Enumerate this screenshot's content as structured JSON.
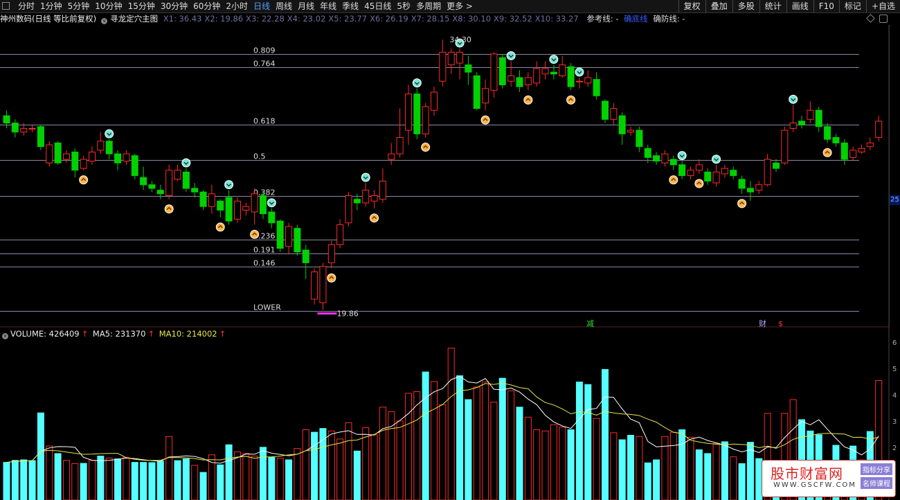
{
  "toolbar": {
    "tabs": [
      {
        "label": "分时",
        "active": false
      },
      {
        "label": "1分钟",
        "active": false
      },
      {
        "label": "5分钟",
        "active": false
      },
      {
        "label": "10分钟",
        "active": false
      },
      {
        "label": "15分钟",
        "active": false
      },
      {
        "label": "30分钟",
        "active": false
      },
      {
        "label": "60分钟",
        "active": false
      },
      {
        "label": "2小时",
        "active": false
      },
      {
        "label": "日线",
        "active": true
      },
      {
        "label": "周线",
        "active": false
      },
      {
        "label": "月线",
        "active": false
      },
      {
        "label": "年线",
        "active": false
      },
      {
        "label": "季线",
        "active": false
      },
      {
        "label": "45日线",
        "active": false
      },
      {
        "label": "5秒",
        "active": false
      },
      {
        "label": "多周期",
        "active": false
      },
      {
        "label": "更多 >",
        "active": false
      }
    ],
    "right_buttons": [
      "复权",
      "叠加",
      "多股",
      "统计",
      "画线",
      "F10",
      "标记",
      "+自选"
    ]
  },
  "info_line": {
    "stock": "神州数码(日线 等比前复权)",
    "indicator": "寻龙定穴主图",
    "values": [
      "X1: 36.43",
      "X2: 19.86",
      "X3: 22.28",
      "X4: 23.02",
      "X5: 23.77",
      "X6: 26.19",
      "X7: 28.15",
      "X8: 30.10",
      "X9: 32.52",
      "X10: 33.27"
    ],
    "ref_label": "参考线: -",
    "mid_label": "确底线",
    "conf_label": "确防线: -"
  },
  "fib_levels": [
    {
      "label": "0.809",
      "value": 34.0
    },
    {
      "label": "0.764",
      "value": 33.27
    },
    {
      "label": "0.618",
      "value": 30.1
    },
    {
      "label": "0.5",
      "value": 28.15
    },
    {
      "label": "0.382",
      "value": 26.19
    },
    {
      "label": "0.236",
      "value": 23.77
    },
    {
      "label": "0.191",
      "value": 23.02
    },
    {
      "label": "0.146",
      "value": 22.28
    },
    {
      "label": "LOWER",
      "value": 19.86
    }
  ],
  "high_label": "34.30",
  "low_label": "19.86",
  "markers_text": {
    "jian": "减",
    "cai": "财",
    "dollar": "$"
  },
  "right_axis_value": "25",
  "volume": {
    "label": "VOLUME: 426409",
    "ma5": "MA5: 231370",
    "ma10": "MA10: 214002",
    "axis_ticks": [
      "6",
      "5",
      "4",
      "3",
      "2"
    ]
  },
  "watermark": {
    "title": "股市财富网",
    "url": "WWW.GSCFW.COM",
    "badge1": "指标分享",
    "badge2": "名师课程"
  },
  "colors": {
    "up": "#ff2a2a",
    "down": "#00d100",
    "vol_down": "#55ffff",
    "ma5": "#ffffff",
    "ma10": "#e8e84a",
    "fib": "#8a8aa8"
  },
  "chart_data": {
    "type": "candlestick",
    "ylim": [
      19.2,
      35.6
    ],
    "candles": [
      [
        30.6,
        30.2,
        30.9,
        29.9
      ],
      [
        30.2,
        29.7,
        30.4,
        29.4
      ],
      [
        29.7,
        29.9,
        30.2,
        29.5
      ],
      [
        29.9,
        29.9,
        30.1,
        29.7
      ],
      [
        30.0,
        28.9,
        30.1,
        28.7
      ],
      [
        28.0,
        29.0,
        29.2,
        27.8
      ],
      [
        29.1,
        28.0,
        29.2,
        27.9
      ],
      [
        28.2,
        28.5,
        28.7,
        28.0
      ],
      [
        28.6,
        27.6,
        28.8,
        27.2
      ],
      [
        27.7,
        28.2,
        28.4,
        27.6
      ],
      [
        28.1,
        28.6,
        28.9,
        27.9
      ],
      [
        28.7,
        29.2,
        29.7,
        28.5
      ],
      [
        29.2,
        28.5,
        29.3,
        28.2
      ],
      [
        28.5,
        28.0,
        28.7,
        27.6
      ],
      [
        28.1,
        28.5,
        28.7,
        27.9
      ],
      [
        28.4,
        27.3,
        28.5,
        27.1
      ],
      [
        27.2,
        26.8,
        27.8,
        26.5
      ],
      [
        26.8,
        26.6,
        27.0,
        26.4
      ],
      [
        26.5,
        26.3,
        26.8,
        26.0
      ],
      [
        26.2,
        27.6,
        27.9,
        26.0
      ],
      [
        27.1,
        27.6,
        27.9,
        27.0
      ],
      [
        27.5,
        26.6,
        27.7,
        26.4
      ],
      [
        26.6,
        26.4,
        26.9,
        26.1
      ],
      [
        26.4,
        25.6,
        26.5,
        25.4
      ],
      [
        25.6,
        26.3,
        26.8,
        25.2
      ],
      [
        25.9,
        25.4,
        26.0,
        25.0
      ],
      [
        26.1,
        24.8,
        26.5,
        24.6
      ],
      [
        24.9,
        25.9,
        26.1,
        24.7
      ],
      [
        25.4,
        25.6,
        25.8,
        25.1
      ],
      [
        25.3,
        26.3,
        26.6,
        24.6
      ],
      [
        26.2,
        25.2,
        26.4,
        24.9
      ],
      [
        25.3,
        24.7,
        25.5,
        24.4
      ],
      [
        24.8,
        23.3,
        24.9,
        23.1
      ],
      [
        23.4,
        24.5,
        24.7,
        23.0
      ],
      [
        24.4,
        23.1,
        24.6,
        22.9
      ],
      [
        23.2,
        22.5,
        23.5,
        21.6
      ],
      [
        20.5,
        22.0,
        22.2,
        20.2
      ],
      [
        20.3,
        22.3,
        22.5,
        19.9
      ],
      [
        22.5,
        23.5,
        23.7,
        22.2
      ],
      [
        23.5,
        24.6,
        24.9,
        23.3
      ],
      [
        24.7,
        26.2,
        26.4,
        24.5
      ],
      [
        26.0,
        25.8,
        26.3,
        25.4
      ],
      [
        25.8,
        26.5,
        26.9,
        25.6
      ],
      [
        25.9,
        26.2,
        26.5,
        25.5
      ],
      [
        26.0,
        27.0,
        27.7,
        25.8
      ],
      [
        28.2,
        28.5,
        29.1,
        27.9
      ],
      [
        28.5,
        29.4,
        31.0,
        28.3
      ],
      [
        29.8,
        31.8,
        32.3,
        29.0
      ],
      [
        31.8,
        29.6,
        32.1,
        29.3
      ],
      [
        29.6,
        31.1,
        31.3,
        29.4
      ],
      [
        30.9,
        31.9,
        32.2,
        30.6
      ],
      [
        32.5,
        34.1,
        34.8,
        32.2
      ],
      [
        33.4,
        34.1,
        34.3,
        32.9
      ],
      [
        33.5,
        34.1,
        34.3,
        32.6
      ],
      [
        33.4,
        33.0,
        33.9,
        32.3
      ],
      [
        32.8,
        31.0,
        33.0,
        30.9
      ],
      [
        31.3,
        32.1,
        32.6,
        30.9
      ],
      [
        32.0,
        34.0,
        34.1,
        31.6
      ],
      [
        33.8,
        32.3,
        34.0,
        32.1
      ],
      [
        32.5,
        32.8,
        33.6,
        32.2
      ],
      [
        32.7,
        32.2,
        33.1,
        31.9
      ],
      [
        32.3,
        32.7,
        33.0,
        32.0
      ],
      [
        32.4,
        33.2,
        33.6,
        32.2
      ],
      [
        32.9,
        33.2,
        33.6,
        32.6
      ],
      [
        33.0,
        32.9,
        33.4,
        32.6
      ],
      [
        32.8,
        33.4,
        33.9,
        32.7
      ],
      [
        33.3,
        32.2,
        33.5,
        32.0
      ],
      [
        32.5,
        32.5,
        32.7,
        32.1
      ],
      [
        32.4,
        32.7,
        33.1,
        32.2
      ],
      [
        32.6,
        31.7,
        33.0,
        31.5
      ],
      [
        31.4,
        30.4,
        31.5,
        30.2
      ],
      [
        30.4,
        31.0,
        31.3,
        30.1
      ],
      [
        30.6,
        29.6,
        30.8,
        29.0
      ],
      [
        29.7,
        29.8,
        30.0,
        29.5
      ],
      [
        29.8,
        28.9,
        30.0,
        28.6
      ],
      [
        28.8,
        28.3,
        29.0,
        28.0
      ],
      [
        28.4,
        28.1,
        28.6,
        27.9
      ],
      [
        28.0,
        28.5,
        28.7,
        27.8
      ],
      [
        28.2,
        27.9,
        28.4,
        27.6
      ],
      [
        27.9,
        27.3,
        28.1,
        27.1
      ],
      [
        27.3,
        27.6,
        27.8,
        27.1
      ],
      [
        27.6,
        27.9,
        28.2,
        27.4
      ],
      [
        27.5,
        27.0,
        27.7,
        26.8
      ],
      [
        26.9,
        27.5,
        27.9,
        26.7
      ],
      [
        27.4,
        27.7,
        27.9,
        27.2
      ],
      [
        27.6,
        27.3,
        27.8,
        27.1
      ],
      [
        27.1,
        26.6,
        27.3,
        26.3
      ],
      [
        26.6,
        26.4,
        27.0,
        25.9
      ],
      [
        26.5,
        26.8,
        27.0,
        26.3
      ],
      [
        26.8,
        28.2,
        28.5,
        26.7
      ],
      [
        28.0,
        27.7,
        28.2,
        27.5
      ],
      [
        28.0,
        29.8,
        30.0,
        27.9
      ],
      [
        29.9,
        30.2,
        31.2,
        29.7
      ],
      [
        30.3,
        30.1,
        30.6,
        29.9
      ],
      [
        30.4,
        30.9,
        31.4,
        30.2
      ],
      [
        30.9,
        30.0,
        31.1,
        29.7
      ],
      [
        30.0,
        29.3,
        30.2,
        29.1
      ],
      [
        29.4,
        29.1,
        29.6,
        28.9
      ],
      [
        29.1,
        28.2,
        29.3,
        27.9
      ],
      [
        28.3,
        28.7,
        28.9,
        28.1
      ],
      [
        28.6,
        28.8,
        29.0,
        28.5
      ],
      [
        28.9,
        29.1,
        29.4,
        28.7
      ],
      [
        29.4,
        30.3,
        30.6,
        29.2
      ]
    ],
    "volume": [
      [
        0,
        0.15
      ],
      [
        0,
        0.158
      ],
      [
        0,
        0.16
      ],
      [
        0,
        0.157
      ],
      [
        0,
        0.347
      ],
      [
        1,
        0.215
      ],
      [
        0,
        0.185
      ],
      [
        1,
        0.158
      ],
      [
        1,
        0.145
      ],
      [
        0,
        0.146
      ],
      [
        1,
        0.158
      ],
      [
        0,
        0.175
      ],
      [
        1,
        0.167
      ],
      [
        0,
        0.164
      ],
      [
        1,
        0.17
      ],
      [
        0,
        0.15
      ],
      [
        0,
        0.15
      ],
      [
        0,
        0.149
      ],
      [
        0,
        0.155
      ],
      [
        1,
        0.253
      ],
      [
        0,
        0.157
      ],
      [
        0,
        0.164
      ],
      [
        1,
        0.138
      ],
      [
        0,
        0.11
      ],
      [
        1,
        0.18
      ],
      [
        0,
        0.14
      ],
      [
        0,
        0.22
      ],
      [
        1,
        0.192
      ],
      [
        1,
        0.185
      ],
      [
        1,
        0.175
      ],
      [
        0,
        0.21
      ],
      [
        0,
        0.17
      ],
      [
        1,
        0.167
      ],
      [
        0,
        0.16
      ],
      [
        1,
        0.205
      ],
      [
        1,
        0.28
      ],
      [
        0,
        0.27
      ],
      [
        0,
        0.285
      ],
      [
        1,
        0.275
      ],
      [
        1,
        0.243
      ],
      [
        1,
        0.308
      ],
      [
        0,
        0.195
      ],
      [
        1,
        0.288
      ],
      [
        1,
        0.26
      ],
      [
        1,
        0.37
      ],
      [
        1,
        0.352
      ],
      [
        1,
        0.315
      ],
      [
        1,
        0.425
      ],
      [
        1,
        0.432
      ],
      [
        0,
        0.51
      ],
      [
        1,
        0.472
      ],
      [
        1,
        0.38
      ],
      [
        1,
        0.605
      ],
      [
        0,
        0.495
      ],
      [
        0,
        0.4
      ],
      [
        1,
        0.45
      ],
      [
        1,
        0.47
      ],
      [
        1,
        0.39
      ],
      [
        0,
        0.485
      ],
      [
        1,
        0.435
      ],
      [
        0,
        0.37
      ],
      [
        1,
        0.33
      ],
      [
        1,
        0.28
      ],
      [
        1,
        0.275
      ],
      [
        1,
        0.3
      ],
      [
        1,
        0.29
      ],
      [
        0,
        0.28
      ],
      [
        0,
        0.47
      ],
      [
        0,
        0.46
      ],
      [
        1,
        0.325
      ],
      [
        0,
        0.52
      ],
      [
        1,
        0.268
      ],
      [
        0,
        0.24
      ],
      [
        0,
        0.258
      ],
      [
        1,
        0.253
      ],
      [
        0,
        0.148
      ],
      [
        0,
        0.16
      ],
      [
        1,
        0.253
      ],
      [
        1,
        0.27
      ],
      [
        0,
        0.28
      ],
      [
        1,
        0.25
      ],
      [
        0,
        0.2
      ],
      [
        0,
        0.185
      ],
      [
        1,
        0.225
      ],
      [
        0,
        0.232
      ],
      [
        1,
        0.172
      ],
      [
        0,
        0.145
      ],
      [
        0,
        0.23
      ],
      [
        0,
        0.165
      ],
      [
        1,
        0.345
      ],
      [
        0,
        0.158
      ],
      [
        1,
        0.345
      ],
      [
        1,
        0.4
      ],
      [
        0,
        0.32
      ],
      [
        0,
        0.275
      ],
      [
        0,
        0.26
      ],
      [
        1,
        0.155
      ],
      [
        0,
        0.218
      ],
      [
        1,
        0.15
      ],
      [
        0,
        0.215
      ],
      [
        1,
        0.16
      ],
      [
        0,
        0.273
      ],
      [
        1,
        0.476
      ]
    ]
  }
}
